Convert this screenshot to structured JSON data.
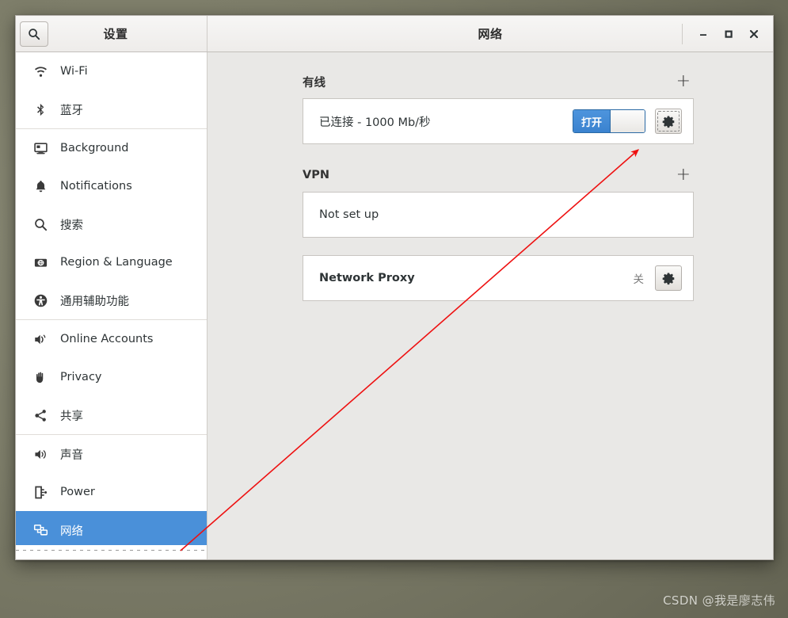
{
  "window": {
    "sidebar_title": "设置",
    "title": "网络",
    "search_icon": "search-icon",
    "controls": {
      "minimize": "minimize-icon",
      "maximize": "maximize-icon",
      "close": "close-icon"
    }
  },
  "sidebar": {
    "items": [
      {
        "label": "Wi-Fi",
        "icon": "wifi-icon",
        "selected": false,
        "sep_after": false
      },
      {
        "label": "蓝牙",
        "icon": "bluetooth-icon",
        "selected": false,
        "sep_after": true
      },
      {
        "label": "Background",
        "icon": "monitor-icon",
        "selected": false,
        "sep_after": false
      },
      {
        "label": "Notifications",
        "icon": "bell-icon",
        "selected": false,
        "sep_after": false
      },
      {
        "label": "搜索",
        "icon": "search-icon",
        "selected": false,
        "sep_after": false
      },
      {
        "label": "Region & Language",
        "icon": "region-icon",
        "selected": false,
        "sep_after": false
      },
      {
        "label": "通用辅助功能",
        "icon": "accessibility-icon",
        "selected": false,
        "sep_after": true
      },
      {
        "label": "Online Accounts",
        "icon": "online-accounts-icon",
        "selected": false,
        "sep_after": false
      },
      {
        "label": "Privacy",
        "icon": "hand-icon",
        "selected": false,
        "sep_after": false
      },
      {
        "label": "共享",
        "icon": "share-icon",
        "selected": false,
        "sep_after": true
      },
      {
        "label": "声音",
        "icon": "speaker-icon",
        "selected": false,
        "sep_after": false
      },
      {
        "label": "Power",
        "icon": "power-plug-icon",
        "selected": false,
        "sep_after": false
      },
      {
        "label": "网络",
        "icon": "network-icon",
        "selected": true,
        "sep_after": false
      }
    ]
  },
  "content": {
    "wired": {
      "title": "有线",
      "add_label": "+",
      "status": "已连接 - 1000 Mb/秒",
      "toggle_label": "打开",
      "toggle_on": true,
      "settings_icon": "gear-icon"
    },
    "vpn": {
      "title": "VPN",
      "add_label": "+",
      "status": "Not set up"
    },
    "proxy": {
      "title": "Network Proxy",
      "status": "关",
      "settings_icon": "gear-icon"
    }
  },
  "annotation": {
    "arrow_color": "#ee1111",
    "description": "red-arrow-pointing-to-wired-settings-gear"
  },
  "watermark": "CSDN @我是廖志伟",
  "colors": {
    "selection_blue": "#4a90d9",
    "toggle_blue": "#3a82cf",
    "content_bg": "#e9e8e6",
    "desktop": "#7e7e6a"
  }
}
